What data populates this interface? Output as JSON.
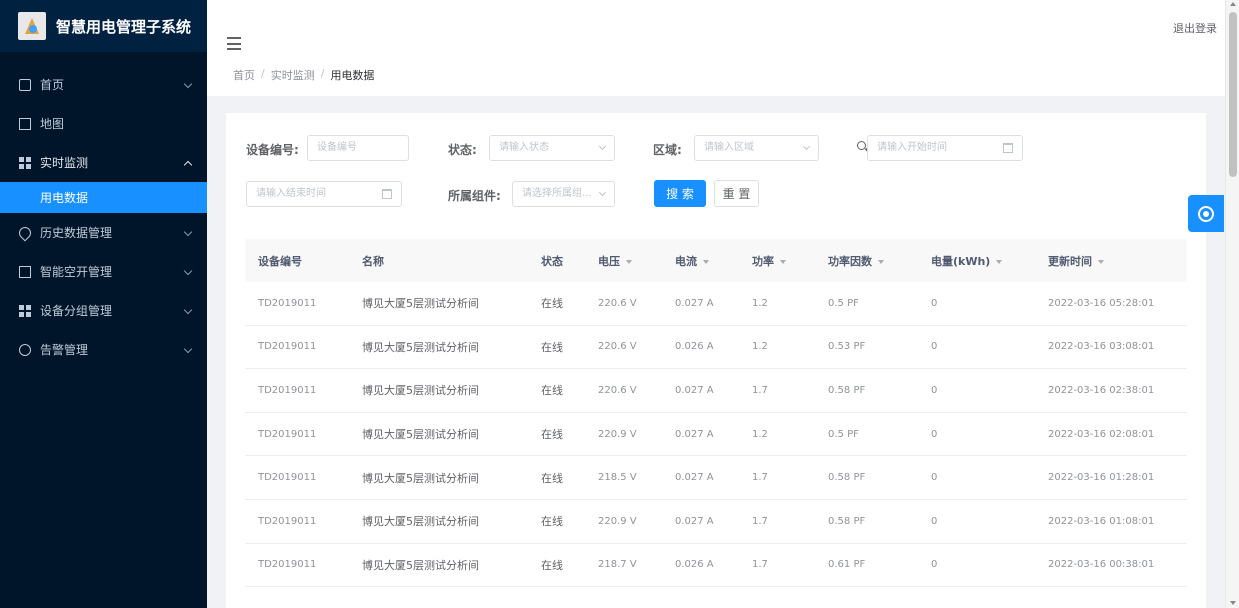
{
  "app": {
    "title": "智慧用电管理子系统"
  },
  "sidebar": {
    "items": [
      {
        "label": "首页",
        "icon": "monitor-icon"
      },
      {
        "label": "地图",
        "icon": "home-icon"
      },
      {
        "label": "实时监测",
        "icon": "grid-icon",
        "open": true
      },
      {
        "label": "历史数据管理",
        "icon": "pin-icon"
      },
      {
        "label": "智能空开管理",
        "icon": "box-icon"
      },
      {
        "label": "设备分组管理",
        "icon": "grid-icon"
      },
      {
        "label": "告警管理",
        "icon": "user-icon"
      }
    ],
    "active_sub": "用电数据"
  },
  "header": {
    "logout": "退出登录"
  },
  "breadcrumb": {
    "home": "首页",
    "parent": "实时监测",
    "current": "用电数据"
  },
  "filters": {
    "device_id_label": "设备编号:",
    "device_id_placeholder": "设备编号",
    "status_label": "状态:",
    "status_placeholder": "请输入状态",
    "region_label": "区域:",
    "region_placeholder": "请输入区域",
    "start_time_placeholder": "请输入开始时间",
    "end_time_placeholder": "请输入结束时间",
    "group_label": "所属组件:",
    "group_placeholder": "请选择所属组...",
    "search_btn": "搜 索",
    "reset_btn": "重 置"
  },
  "table": {
    "columns": [
      "设备编号",
      "名称",
      "状态",
      "电压",
      "电流",
      "功率",
      "功率因数",
      "电量(kWh)",
      "更新时间"
    ],
    "rows": [
      [
        "TD2019011",
        "博见大厦5层测试分析间",
        "在线",
        "220.6 V",
        "0.027 A",
        "1.2",
        "0.5 PF",
        "0",
        "2022-03-16 05:28:01"
      ],
      [
        "TD2019011",
        "博见大厦5层测试分析间",
        "在线",
        "220.6 V",
        "0.026 A",
        "1.2",
        "0.53 PF",
        "0",
        "2022-03-16 03:08:01"
      ],
      [
        "TD2019011",
        "博见大厦5层测试分析间",
        "在线",
        "220.6 V",
        "0.027 A",
        "1.7",
        "0.58 PF",
        "0",
        "2022-03-16 02:38:01"
      ],
      [
        "TD2019011",
        "博见大厦5层测试分析间",
        "在线",
        "220.9 V",
        "0.027 A",
        "1.2",
        "0.5 PF",
        "0",
        "2022-03-16 02:08:01"
      ],
      [
        "TD2019011",
        "博见大厦5层测试分析间",
        "在线",
        "218.5 V",
        "0.027 A",
        "1.7",
        "0.58 PF",
        "0",
        "2022-03-16 01:28:01"
      ],
      [
        "TD2019011",
        "博见大厦5层测试分析间",
        "在线",
        "220.9 V",
        "0.027 A",
        "1.7",
        "0.58 PF",
        "0",
        "2022-03-16 01:08:01"
      ],
      [
        "TD2019011",
        "博见大厦5层测试分析间",
        "在线",
        "218.7 V",
        "0.026 A",
        "1.7",
        "0.61 PF",
        "0",
        "2022-03-16 00:38:01"
      ]
    ]
  }
}
